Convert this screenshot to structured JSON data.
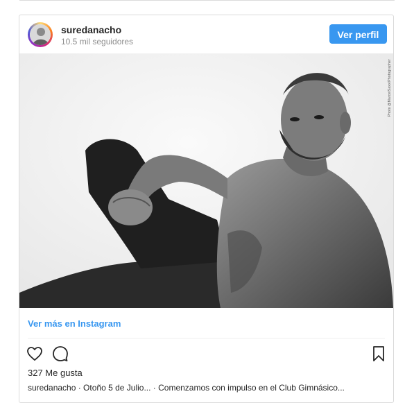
{
  "post": {
    "username": "suredanacho",
    "followers": "10.5 mil seguidores",
    "follow_label": "Ver perfil",
    "photo_credit": "Photo @MarcelSaxx/Photographer",
    "view_more_label": "Ver más en Instagram",
    "likes": "327 Me gusta",
    "caption": "suredanacho · Otoño 5 de Julio... · Comenzamos con impulso en el Club Gimnásico..."
  },
  "icons": {
    "like": "heart-icon",
    "comment": "comment-icon",
    "save": "bookmark-icon"
  },
  "colors": {
    "accent": "#3897f0",
    "border": "#dbdbdb",
    "muted": "#8e8e8e"
  }
}
